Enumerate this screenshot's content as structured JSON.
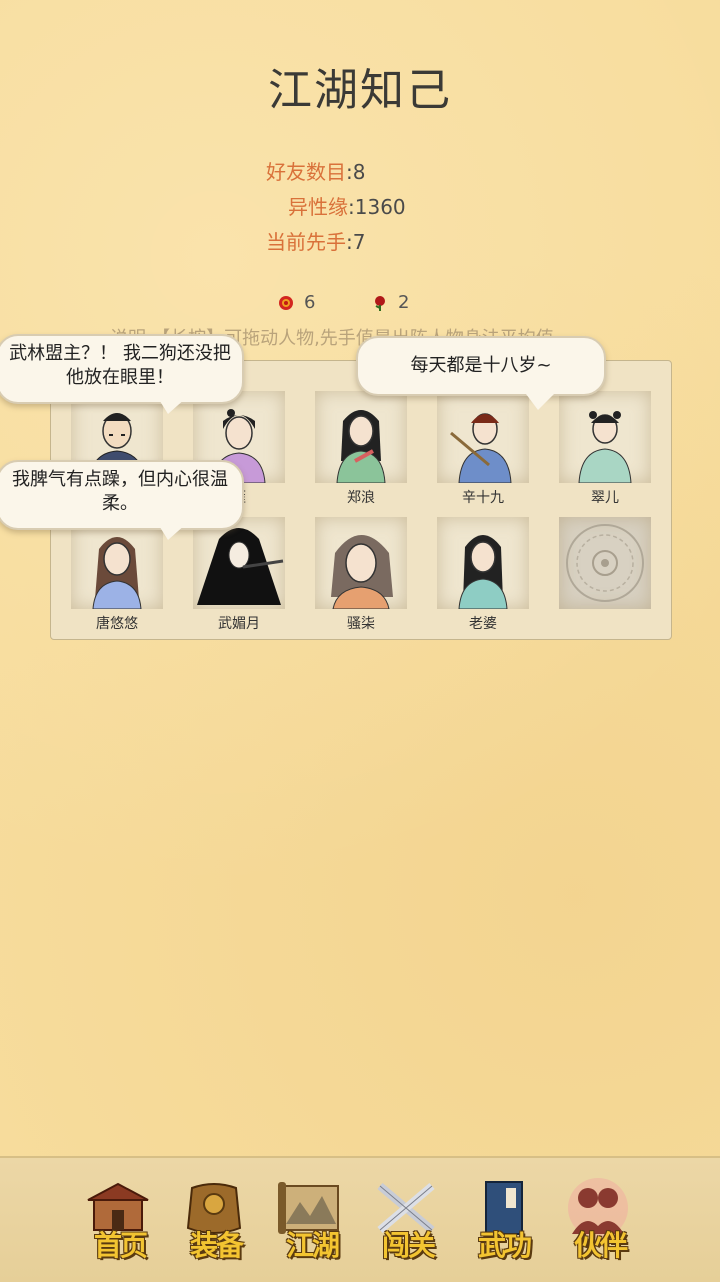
{
  "title": "江湖知己",
  "stats": [
    {
      "key": "好友数目",
      "value": ":8"
    },
    {
      "key": "异性缘",
      "value": ":1360"
    },
    {
      "key": "当前先手",
      "value": ":7"
    }
  ],
  "counters": {
    "red_roses": "6",
    "dark_roses": "2"
  },
  "note": "说明:【长按】可拖动人物,先手值是出阵人物身法平均值.",
  "bubbles": [
    "武林盟主？！ 我二狗还没把他放在眼里！",
    "每天都是十八岁~",
    "我脾气有点躁，但内心很温柔。"
  ],
  "characters": [
    {
      "name": ""
    },
    {
      "name": "雁"
    },
    {
      "name": "郑浪"
    },
    {
      "name": "辛十九"
    },
    {
      "name": "翠儿"
    },
    {
      "name": "唐悠悠"
    },
    {
      "name": "武媚月"
    },
    {
      "name": "骚柒"
    },
    {
      "name": "老婆"
    },
    {
      "name": ""
    }
  ],
  "nav": [
    {
      "label": "首页",
      "icon": "house-icon"
    },
    {
      "label": "装备",
      "icon": "armor-icon"
    },
    {
      "label": "江湖",
      "icon": "scroll-icon"
    },
    {
      "label": "闯关",
      "icon": "crossed-swords-icon"
    },
    {
      "label": "武功",
      "icon": "book-icon"
    },
    {
      "label": "伙伴",
      "icon": "companions-icon"
    }
  ],
  "colors": {
    "background": "#f7dc9c",
    "label_accent": "#d9713a",
    "nav_text": "#f3c431"
  }
}
